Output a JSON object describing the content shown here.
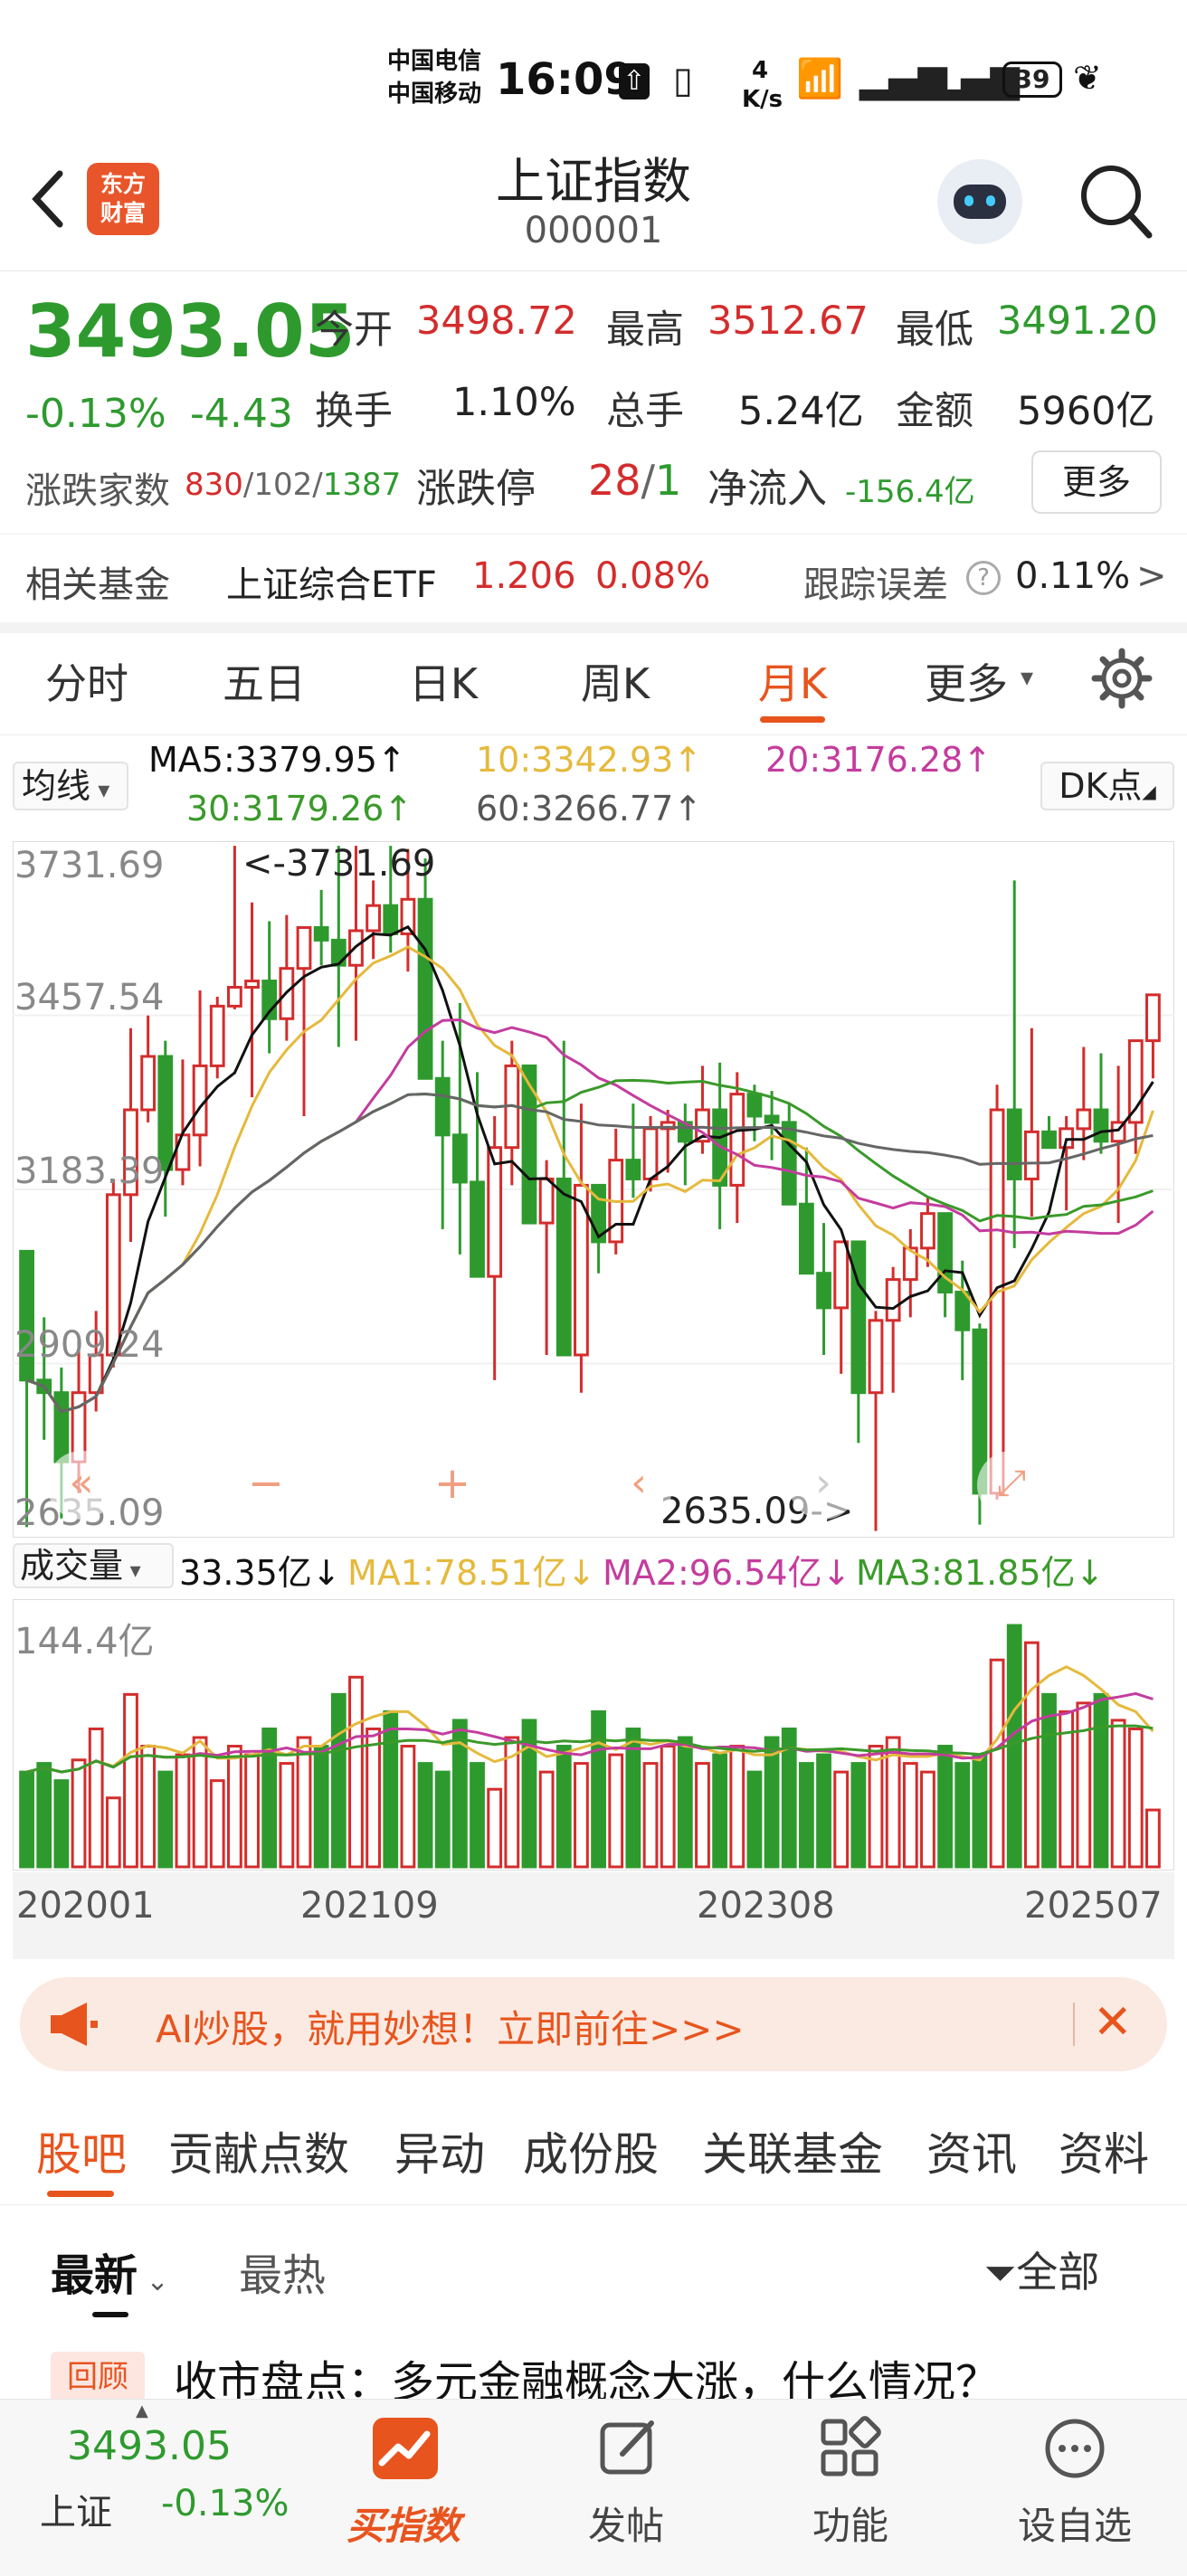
{
  "status_bar": {
    "carrier1": "中国电信",
    "carrier2": "中国移动",
    "time": "16:09",
    "net_speed_top": "4",
    "net_speed_bottom": "K/s",
    "battery": "39"
  },
  "header": {
    "logo_line1": "东方",
    "logo_line2": "财富",
    "title": "上证指数",
    "code": "000001"
  },
  "quote": {
    "price": "3493.05",
    "change_pct": "-0.13%",
    "change": "-4.43",
    "open_label": "今开",
    "open": "3498.72",
    "high_label": "最高",
    "high": "3512.67",
    "low_label": "最低",
    "low": "3491.20",
    "turnover_label": "换手",
    "turnover": "1.10%",
    "volume_label": "总手",
    "volume": "5.24亿",
    "amount_label": "金额",
    "amount": "5960亿",
    "breadth_label": "涨跌家数",
    "up_count": "830",
    "flat_count": "102",
    "down_count": "1387",
    "limit_label": "涨跌停",
    "limit_up": "28",
    "limit_down": "1",
    "inflow_label": "净流入",
    "inflow": "-156.4亿",
    "more_label": "更多"
  },
  "fund": {
    "label": "相关基金",
    "name": "上证综合ETF",
    "price": "1.206",
    "pct": "0.08%",
    "tracking_label": "跟踪误差",
    "tracking_value": "0.11%",
    "chevron": ">"
  },
  "period_tabs": [
    {
      "label": "分时",
      "active": false
    },
    {
      "label": "五日",
      "active": false
    },
    {
      "label": "日K",
      "active": false
    },
    {
      "label": "周K",
      "active": false
    },
    {
      "label": "月K",
      "active": true
    },
    {
      "label": "更多",
      "active": false
    }
  ],
  "indicators": {
    "ma_select": "均线",
    "ma5": "MA5:3379.95",
    "ma10": "10:3342.93",
    "ma20": "20:3176.28",
    "ma30": "30:3179.26",
    "ma60": "60:3266.77",
    "dk_label": "DK点",
    "up_arrow": "↑"
  },
  "chart_data": [
    {
      "type": "candlestick",
      "y_ticks": [
        "3731.69",
        "3457.54",
        "3183.39",
        "2909.24",
        "2635.09"
      ],
      "ylim": [
        2635.09,
        3731.69
      ],
      "high_marker": "<-3731.69",
      "low_marker": "2635.09->",
      "x_ticks": [
        "202001",
        "202109",
        "202308",
        "202507"
      ],
      "candles_ohlc": [
        [
          3085,
          3058,
          2646,
          2880
        ],
        [
          2880,
          2980,
          2785,
          2860
        ],
        [
          2860,
          2900,
          2660,
          2750
        ],
        [
          2750,
          2950,
          2700,
          2860
        ],
        [
          2860,
          2990,
          2830,
          2920
        ],
        [
          2920,
          3200,
          2900,
          3175
        ],
        [
          3175,
          3440,
          3100,
          3310
        ],
        [
          3310,
          3460,
          3290,
          3395
        ],
        [
          3395,
          3420,
          3140,
          3215
        ],
        [
          3215,
          3390,
          3190,
          3270
        ],
        [
          3270,
          3500,
          3220,
          3380
        ],
        [
          3380,
          3490,
          3360,
          3475
        ],
        [
          3475,
          3730,
          3470,
          3505
        ],
        [
          3505,
          3640,
          3330,
          3515
        ],
        [
          3515,
          3610,
          3400,
          3455
        ],
        [
          3455,
          3620,
          3420,
          3535
        ],
        [
          3535,
          3590,
          3300,
          3600
        ],
        [
          3600,
          3660,
          3540,
          3580
        ],
        [
          3580,
          3730,
          3410,
          3540
        ],
        [
          3540,
          3730,
          3420,
          3595
        ],
        [
          3595,
          3675,
          3550,
          3635
        ],
        [
          3635,
          3730,
          3560,
          3590
        ],
        [
          3590,
          3725,
          3530,
          3645
        ],
        [
          3645,
          3710,
          3550,
          3360
        ],
        [
          3360,
          3420,
          3120,
          3270
        ],
        [
          3270,
          3480,
          3080,
          3195
        ],
        [
          3195,
          3370,
          3050,
          3045
        ],
        [
          3045,
          3300,
          2880,
          3250
        ],
        [
          3250,
          3420,
          3190,
          3380
        ],
        [
          3380,
          3350,
          3210,
          3130
        ],
        [
          3130,
          3230,
          2920,
          3200
        ],
        [
          3200,
          3420,
          3020,
          2920
        ],
        [
          2920,
          3320,
          2860,
          3190
        ],
        [
          3190,
          3150,
          3050,
          3100
        ],
        [
          3100,
          3280,
          3080,
          3230
        ],
        [
          3230,
          3320,
          3170,
          3200
        ],
        [
          3200,
          3300,
          3180,
          3280
        ],
        [
          3280,
          3310,
          3210,
          3290
        ],
        [
          3290,
          3320,
          3190,
          3260
        ],
        [
          3260,
          3380,
          3240,
          3310
        ],
        [
          3310,
          3385,
          3120,
          3190
        ],
        [
          3190,
          3370,
          3130,
          3335
        ],
        [
          3335,
          3350,
          3260,
          3300
        ],
        [
          3300,
          3340,
          3230,
          3290
        ],
        [
          3290,
          3320,
          3180,
          3160
        ],
        [
          3160,
          3250,
          3050,
          3050
        ],
        [
          3050,
          3130,
          2920,
          2995
        ],
        [
          2995,
          3000,
          2890,
          3100
        ],
        [
          3100,
          3030,
          2780,
          2860
        ],
        [
          2860,
          2990,
          2640,
          2975
        ],
        [
          2975,
          3060,
          2860,
          3040
        ],
        [
          3040,
          3120,
          2980,
          3090
        ],
        [
          3090,
          3170,
          3060,
          3145
        ],
        [
          3145,
          3110,
          2980,
          3020
        ],
        [
          3020,
          3070,
          2880,
          2960
        ],
        [
          2960,
          2970,
          2650,
          2700
        ],
        [
          2700,
          3350,
          2690,
          3310
        ],
        [
          3310,
          3675,
          3090,
          3200
        ],
        [
          3200,
          3440,
          3140,
          3275
        ],
        [
          3275,
          3300,
          3250,
          3250
        ],
        [
          3250,
          3300,
          3150,
          3280
        ],
        [
          3280,
          3410,
          3230,
          3310
        ],
        [
          3310,
          3400,
          3240,
          3260
        ],
        [
          3260,
          3380,
          3130,
          3290
        ],
        [
          3290,
          3395,
          3240,
          3420
        ],
        [
          3420,
          3480,
          3360,
          3493
        ]
      ],
      "ma_lines": [
        {
          "name": "MA5",
          "color": "#111111"
        },
        {
          "name": "MA10",
          "color": "#e5b93c"
        },
        {
          "name": "MA20",
          "color": "#c43c9e"
        },
        {
          "name": "MA30",
          "color": "#3a9a2a"
        },
        {
          "name": "MA60",
          "color": "#666666"
        }
      ]
    },
    {
      "type": "bar",
      "name": "成交量",
      "y_tick": "144.4亿",
      "current": "33.35亿",
      "ma1": "MA1:78.51亿",
      "ma2": "MA2:96.54亿",
      "ma3": "MA3:81.85亿",
      "values": [
        55,
        60,
        50,
        62,
        80,
        40,
        100,
        70,
        55,
        65,
        75,
        50,
        70,
        65,
        80,
        60,
        75,
        70,
        100,
        110,
        80,
        90,
        70,
        60,
        55,
        85,
        60,
        45,
        75,
        85,
        55,
        70,
        60,
        90,
        65,
        80,
        60,
        70,
        75,
        60,
        65,
        70,
        55,
        75,
        80,
        60,
        65,
        55,
        60,
        70,
        75,
        60,
        55,
        70,
        60,
        65,
        120,
        140,
        130,
        100,
        90,
        95,
        100,
        85,
        80,
        33
      ]
    }
  ],
  "chart_controls": {
    "volume_select": "成交量"
  },
  "banner": {
    "text": "AI炒股，就用妙想！立即前往>>>"
  },
  "guba_tabs": [
    "股吧",
    "贡献点数",
    "异动",
    "成份股",
    "关联基金",
    "资讯",
    "资料"
  ],
  "sort": {
    "latest": "最新",
    "hot": "最热",
    "filter": "全部"
  },
  "post": {
    "tag": "回顾",
    "title": "收市盘点：多元金融概念大涨，什么情况？"
  },
  "bottom_bar": {
    "index_price": "3493.05",
    "index_name": "上证",
    "index_pct": "-0.13%",
    "buy_label": "买指数",
    "post_label": "发帖",
    "func_label": "功能",
    "watch_label": "设自选"
  },
  "colors": {
    "up": "#d42c2c",
    "down": "#2e9a2e",
    "accent": "#e8541e"
  }
}
